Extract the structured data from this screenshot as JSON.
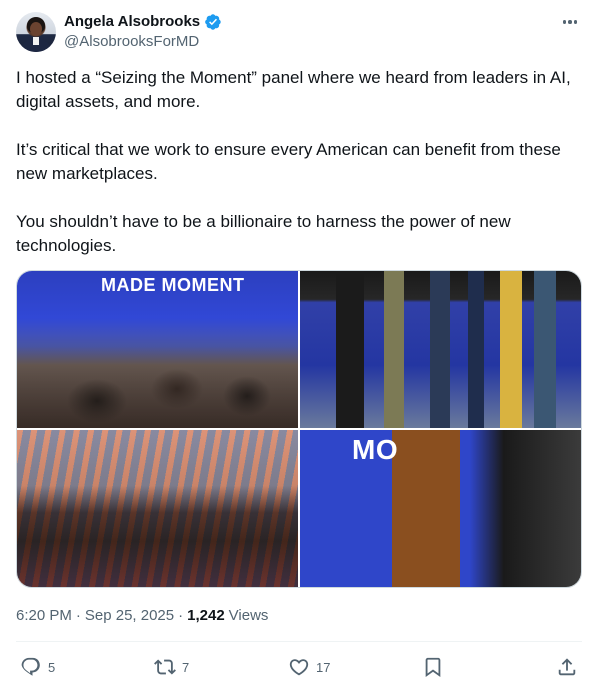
{
  "author": {
    "display_name": "Angela Alsobrooks",
    "handle": "@AlsobrooksForMD",
    "verified": true
  },
  "tweet": {
    "paragraphs": [
      "I hosted a “Seizing the Moment” panel where we heard from leaders in AI, digital assets, and more.",
      "It’s critical that we work to ensure every American can benefit from these new marketplaces.",
      "You shouldn’t have to be a billionaire to harness the power of new technologies."
    ]
  },
  "media": {
    "photo1_sign": "MADE MOMENT",
    "photo2_sign": "",
    "photo4_sign": "MO"
  },
  "meta": {
    "time": "6:20 PM",
    "date": "Sep 25, 2025",
    "separator": "·",
    "views_count": "1,242",
    "views_label": "Views"
  },
  "actions": {
    "replies": "5",
    "reposts": "7",
    "likes": "17"
  },
  "icons": {
    "more": "more-horizontal-icon",
    "verified": "verified-badge-icon",
    "reply": "reply-icon",
    "repost": "repost-icon",
    "like": "heart-icon",
    "bookmark": "bookmark-icon",
    "share": "share-icon"
  },
  "colors": {
    "verified_blue": "#1d9bf0",
    "secondary_text": "#536471",
    "primary_text": "#0f1419"
  }
}
